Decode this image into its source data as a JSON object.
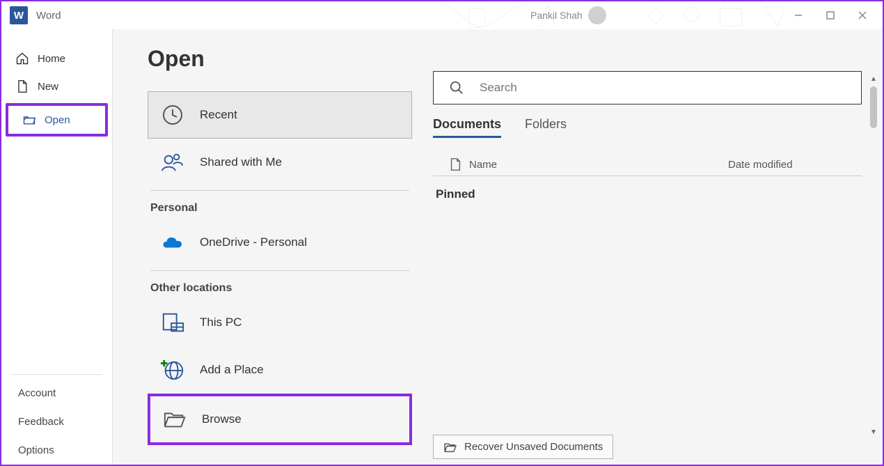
{
  "app": {
    "title": "Word",
    "user_name": "Pankil Shah"
  },
  "leftnav": {
    "home": "Home",
    "new": "New",
    "open": "Open",
    "account": "Account",
    "feedback": "Feedback",
    "options": "Options"
  },
  "open_page": {
    "heading": "Open",
    "locations": {
      "recent": "Recent",
      "shared": "Shared with Me",
      "section_personal": "Personal",
      "onedrive": "OneDrive - Personal",
      "section_other": "Other locations",
      "this_pc": "This PC",
      "add_place": "Add a Place",
      "browse": "Browse"
    }
  },
  "right_panel": {
    "search_placeholder": "Search",
    "tabs": {
      "documents": "Documents",
      "folders": "Folders"
    },
    "columns": {
      "name": "Name",
      "date": "Date modified"
    },
    "pinned_header": "Pinned",
    "recover_button": "Recover Unsaved Documents"
  }
}
